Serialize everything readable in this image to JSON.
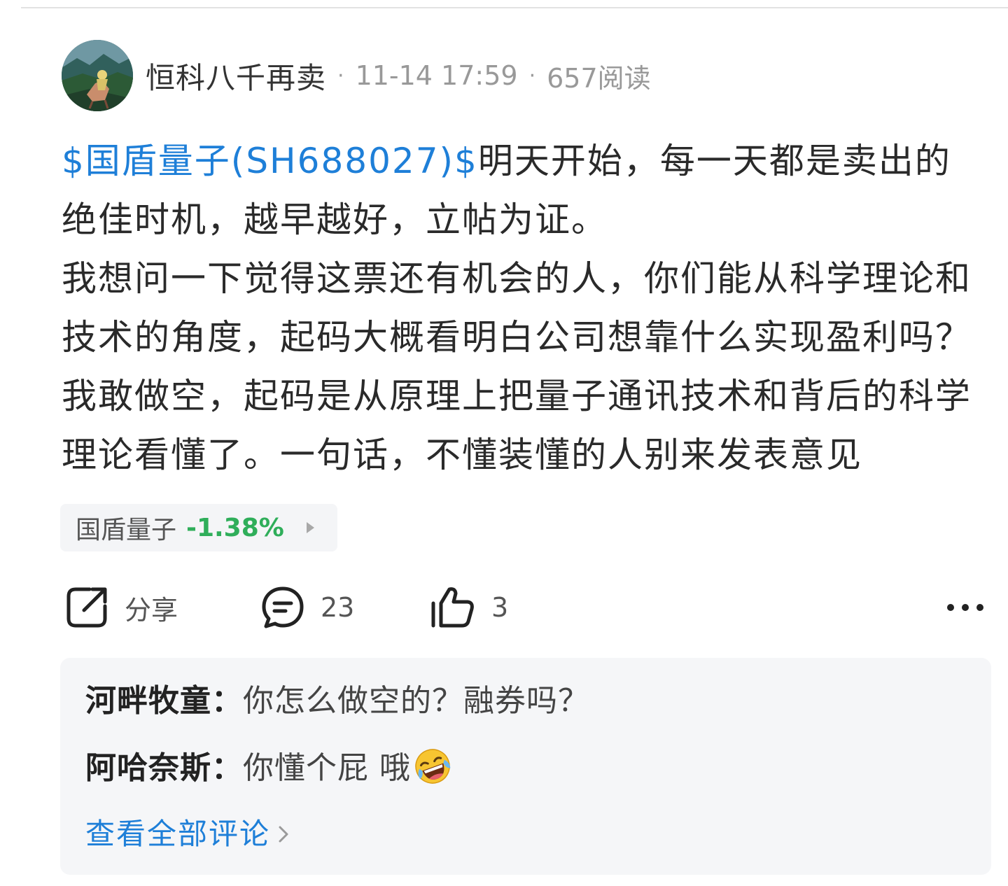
{
  "post": {
    "author": "恒科八千再卖",
    "separator": "·",
    "date": "11-14 17:59",
    "reads": "657阅读",
    "stock_tag": "$国盾量子(SH688027)$",
    "body": "明天开始，每一天都是卖出的绝佳时机，越早越好，立帖为证。\n我想问一下觉得这票还有机会的人，你们能从科学理论和技术的角度，起码大概看明白公司想靠什么实现盈利吗？我敢做空，起码是从原理上把量子通讯技术和背后的科学理论看懂了。一句话，不懂装懂的人别来发表意见"
  },
  "stock_chip": {
    "name": "国盾量子",
    "change": "-1.38%",
    "change_color": "#2fae5a"
  },
  "actions": {
    "share_label": "分享",
    "comment_count": "23",
    "like_count": "3"
  },
  "comments": [
    {
      "author": "河畔牧童：",
      "text": "你怎么做空的？融券吗？"
    },
    {
      "author": "阿哈奈斯：",
      "text": "你懂个屁 哦",
      "emoji": "rolling-on-floor-laughing"
    }
  ],
  "view_all_label": "查看全部评论",
  "colors": {
    "link_blue": "#1e7fd8",
    "down_green": "#2fae5a",
    "meta_gray": "#999999"
  }
}
